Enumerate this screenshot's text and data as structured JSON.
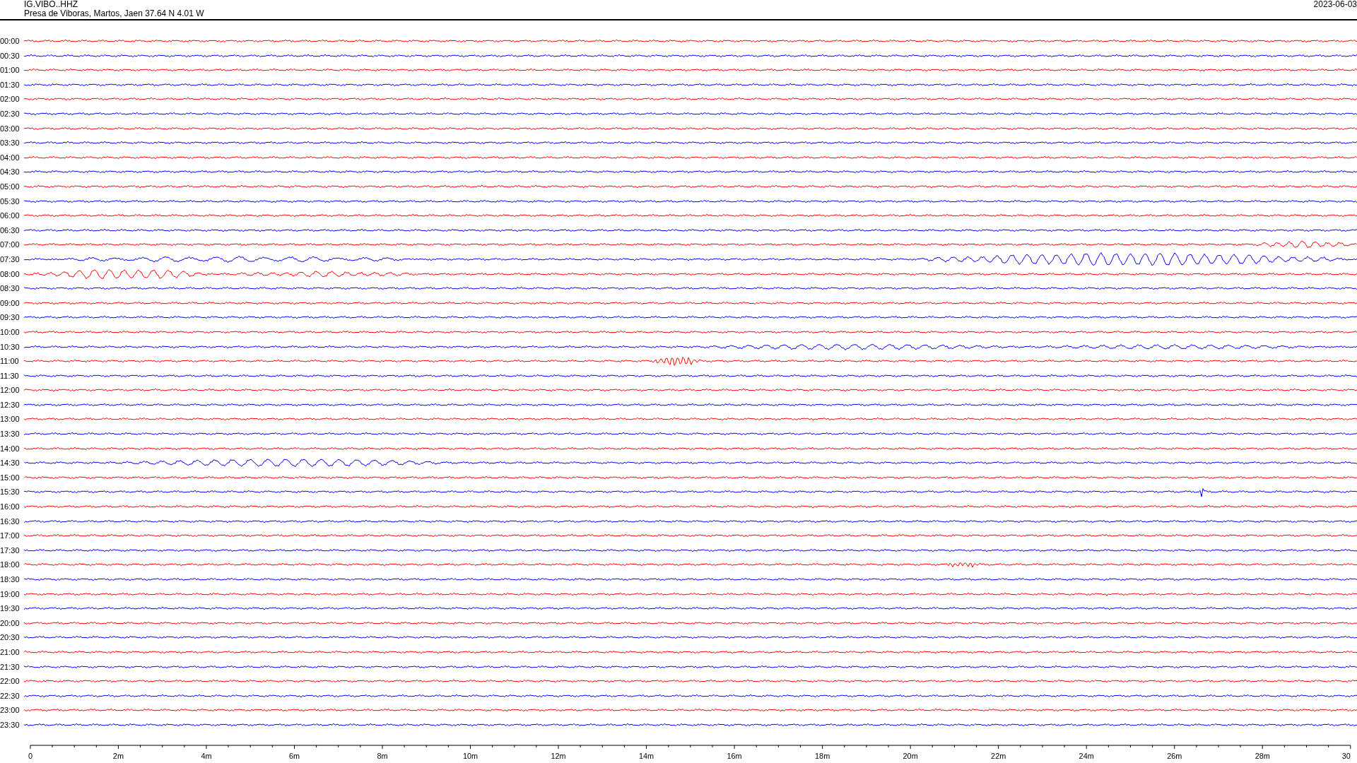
{
  "header": {
    "station": "IG.VIBO..HHZ",
    "location": "Presa de Viboras, Martos, Jaen  37.64 N 4.01 W",
    "date": "2023-06-03"
  },
  "traces": [
    {
      "time": "00:00",
      "color": "#ff0000"
    },
    {
      "time": "00:30",
      "color": "#0000ff"
    },
    {
      "time": "01:00",
      "color": "#ff0000"
    },
    {
      "time": "01:30",
      "color": "#0000ff"
    },
    {
      "time": "02:00",
      "color": "#ff0000"
    },
    {
      "time": "02:30",
      "color": "#0000ff"
    },
    {
      "time": "03:00",
      "color": "#ff0000"
    },
    {
      "time": "03:30",
      "color": "#0000ff"
    },
    {
      "time": "04:00",
      "color": "#ff0000"
    },
    {
      "time": "04:30",
      "color": "#0000ff"
    },
    {
      "time": "05:00",
      "color": "#ff0000"
    },
    {
      "time": "05:30",
      "color": "#0000ff"
    },
    {
      "time": "06:00",
      "color": "#ff0000"
    },
    {
      "time": "06:30",
      "color": "#0000ff"
    },
    {
      "time": "07:00",
      "color": "#ff0000"
    },
    {
      "time": "07:30",
      "color": "#0000ff"
    },
    {
      "time": "08:00",
      "color": "#ff0000"
    },
    {
      "time": "08:30",
      "color": "#0000ff"
    },
    {
      "time": "09:00",
      "color": "#ff0000"
    },
    {
      "time": "09:30",
      "color": "#0000ff"
    },
    {
      "time": "10:00",
      "color": "#ff0000"
    },
    {
      "time": "10:30",
      "color": "#0000ff"
    },
    {
      "time": "11:00",
      "color": "#ff0000"
    },
    {
      "time": "11:30",
      "color": "#0000ff"
    },
    {
      "time": "12:00",
      "color": "#ff0000"
    },
    {
      "time": "12:30",
      "color": "#0000ff"
    },
    {
      "time": "13:00",
      "color": "#ff0000"
    },
    {
      "time": "13:30",
      "color": "#0000ff"
    },
    {
      "time": "14:00",
      "color": "#ff0000"
    },
    {
      "time": "14:30",
      "color": "#0000ff"
    },
    {
      "time": "15:00",
      "color": "#ff0000"
    },
    {
      "time": "15:30",
      "color": "#0000ff"
    },
    {
      "time": "16:00",
      "color": "#ff0000"
    },
    {
      "time": "16:30",
      "color": "#0000ff"
    },
    {
      "time": "17:00",
      "color": "#ff0000"
    },
    {
      "time": "17:30",
      "color": "#0000ff"
    },
    {
      "time": "18:00",
      "color": "#ff0000"
    },
    {
      "time": "18:30",
      "color": "#0000ff"
    },
    {
      "time": "19:00",
      "color": "#ff0000"
    },
    {
      "time": "19:30",
      "color": "#0000ff"
    },
    {
      "time": "20:00",
      "color": "#ff0000"
    },
    {
      "time": "20:30",
      "color": "#0000ff"
    },
    {
      "time": "21:00",
      "color": "#ff0000"
    },
    {
      "time": "21:30",
      "color": "#0000ff"
    },
    {
      "time": "22:00",
      "color": "#ff0000"
    },
    {
      "time": "22:30",
      "color": "#0000ff"
    },
    {
      "time": "23:00",
      "color": "#ff0000"
    },
    {
      "time": "23:30",
      "color": "#0000ff"
    }
  ],
  "axis": {
    "labels": [
      "0",
      "2m",
      "4m",
      "6m",
      "8m",
      "10m",
      "12m",
      "14m",
      "16m",
      "18m",
      "20m",
      "22m",
      "24m",
      "26m",
      "28m",
      "30"
    ]
  }
}
